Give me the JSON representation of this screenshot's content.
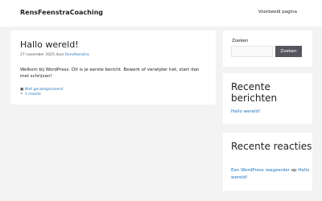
{
  "header": {
    "site_title": "RensFeenstraCoaching",
    "nav_item": "Voorbeeld pagina"
  },
  "post": {
    "title": "Hallo wereld!",
    "meta_date": "27 november 2025",
    "meta_by": "door",
    "meta_author": "Rensfeenstra",
    "body": "Welkom bij WordPress. Dit is je eerste bericht. Bewerk of verwijder het, start dan met schrijven!",
    "category_icon": "folder-icon",
    "category": "Niet gecategoriseerd",
    "comments_icon": "comment-icon",
    "comments": "1 reactie"
  },
  "sidebar": {
    "search": {
      "label": "Zoeken",
      "placeholder": "",
      "button": "Zoeken"
    },
    "recent_posts": {
      "title": "Recente berichten",
      "items": [
        "Hallo wereld!"
      ]
    },
    "recent_comments": {
      "title": "Recente reacties",
      "author": "Een WordPress reageerder",
      "on": "op",
      "post": "Hallo wereld!"
    }
  },
  "colors": {
    "background": "#f3f3f3",
    "link": "#1e73be",
    "button": "#55555e"
  }
}
